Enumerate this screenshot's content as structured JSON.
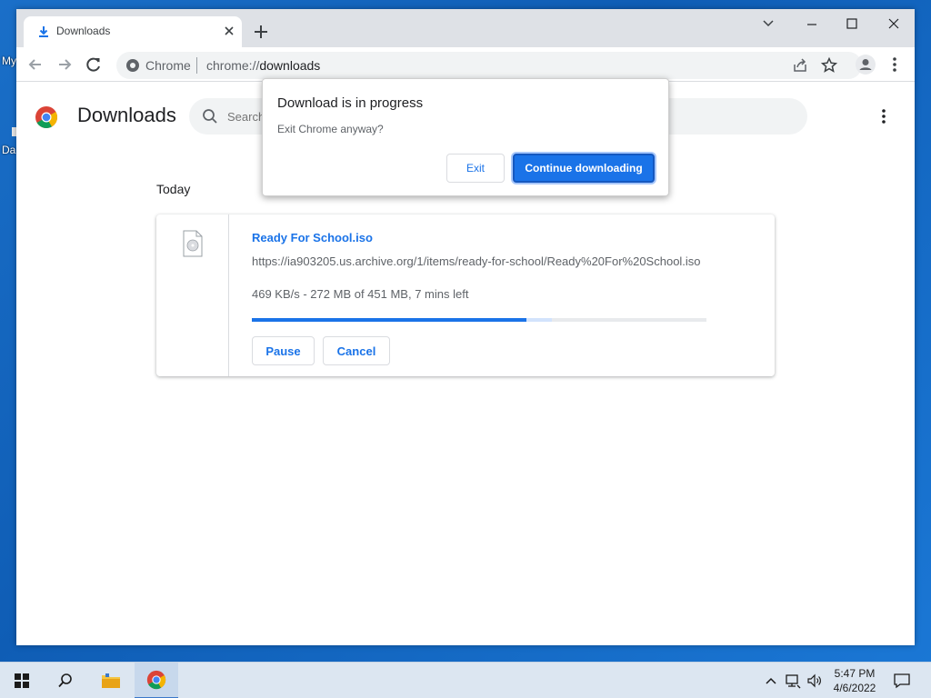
{
  "desktop": {
    "label_top": "My",
    "label_bottom": "Da"
  },
  "browser": {
    "tab": {
      "title": "Downloads",
      "icon": "download-icon"
    },
    "window_controls": [
      "minimize-icon",
      "maximize-icon",
      "close-icon"
    ],
    "toolbar": {
      "site_label": "Chrome",
      "url_scheme": "chrome://",
      "url_host": "downloads"
    }
  },
  "downloads_page": {
    "title": "Downloads",
    "search_placeholder": "Search downloads",
    "section_label": "Today",
    "items": [
      {
        "file_name": "Ready For School.iso",
        "url": "https://ia903205.us.archive.org/1/items/ready-for-school/Ready%20For%20School.iso",
        "status": "469 KB/s - 272 MB of 451 MB, 7 mins left",
        "progress_fraction": 0.603,
        "buffer_fraction": 0.66,
        "pause_label": "Pause",
        "cancel_label": "Cancel"
      }
    ]
  },
  "dialog": {
    "title": "Download is in progress",
    "body": "Exit Chrome anyway?",
    "exit_label": "Exit",
    "continue_label": "Continue downloading"
  },
  "taskbar": {
    "items": [
      "windows-start-icon",
      "search-icon",
      "file-explorer-icon",
      "chrome-icon"
    ],
    "time": "5:47 PM",
    "date": "4/6/2022"
  },
  "colors": {
    "accent": "#1a73e8",
    "desktop": "#1a6fc8"
  }
}
